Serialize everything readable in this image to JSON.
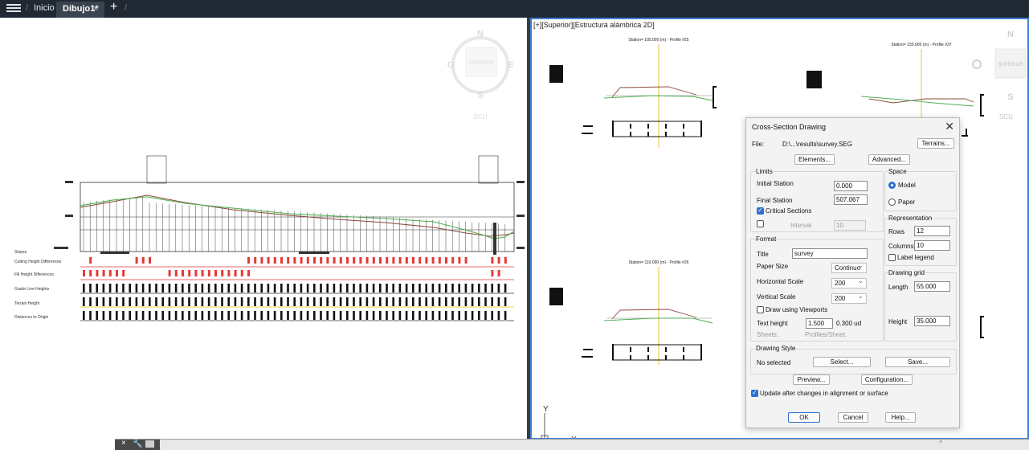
{
  "topbar": {
    "crumb_home": "Inicio",
    "tab_active": "Dibujo1*",
    "tab_close": "×",
    "new_tab": "+"
  },
  "left_view": {
    "rows": [
      "Slopes",
      "Cutting Height Differences",
      "Fill Height Differences",
      "Grade Line Heights",
      "Terrain Height",
      "Distances to Origin"
    ],
    "cube": {
      "n": "N",
      "s": "S",
      "e": "E",
      "o": "O",
      "face": "SUPERIOR",
      "ucs": "SCU"
    }
  },
  "right_view": {
    "label": "[+][Superior][Estructura alámbrica 2D]",
    "sections": [
      "Station= 105.000 (m) - Profile #25",
      "Station= 155.000 (m) - Profile #37",
      "Station= 110.000 (m) - Profile #26"
    ],
    "cube": {
      "n": "N",
      "s": "S",
      "face": "SUPERIOR",
      "ucs": "SCU"
    },
    "ucs_axis": {
      "x": "X",
      "y": "Y"
    }
  },
  "dialog": {
    "title": "Cross-Section Drawing",
    "file_label": "File:",
    "file_value": "D:\\...\\results\\survey.SEG",
    "terrains": "Terrains...",
    "elements": "Elements...",
    "advanced": "Advanced...",
    "limits": {
      "heading": "Limits",
      "initial_label": "Initial Station",
      "initial_value": "0.000",
      "final_label": "Final Station",
      "final_value": "507.067",
      "critical_label": "Critical Sections",
      "interval_label": "Interval",
      "interval_value": "10"
    },
    "space": {
      "heading": "Space",
      "model": "Model",
      "paper": "Paper"
    },
    "representation": {
      "heading": "Representation",
      "rows_label": "Rows",
      "rows_value": "12",
      "columns_label": "Columns",
      "columns_value": "10",
      "legend_label": "Label legend"
    },
    "format": {
      "heading": "Format",
      "title_label": "Title",
      "title_value": "survey",
      "paper_label": "Paper Size",
      "paper_value": "Continuo",
      "hscale_label": "Horizontal Scale",
      "hscale_value": "200",
      "vscale_label": "Vertical Scale",
      "vscale_value": "200",
      "viewports_label": "Draw using Viewports",
      "text_label": "Text height",
      "text_value": "1.500",
      "text_units": "0.300 ud",
      "sheets_label": "Sheets:",
      "profiles_label": "Profiles/Sheet:"
    },
    "grid": {
      "heading": "Drawing grid",
      "length_label": "Length",
      "length_value": "55.000",
      "height_label": "Height",
      "height_value": "35.000"
    },
    "style": {
      "heading": "Drawing Style",
      "value": "No selected",
      "select": "Select...",
      "save": "Save..."
    },
    "preview": "Preview...",
    "configuration": "Configuration...",
    "update_label": "Update after changes in alignment or surface",
    "ok": "OK",
    "cancel": "Cancel",
    "help": "Help..."
  },
  "cmdline": {
    "close": "×",
    "caret": "^"
  }
}
